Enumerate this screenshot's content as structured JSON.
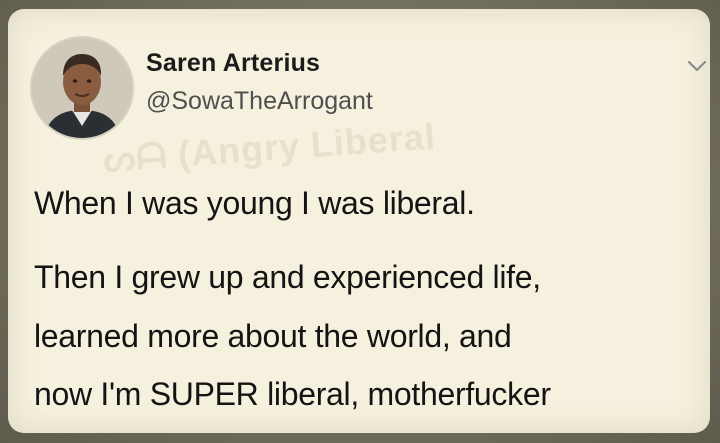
{
  "tweet": {
    "author_name": "Saren Arterius",
    "author_handle": "@SowaTheArrogant",
    "watermark": "ᔕᗩ (Angry Liberal",
    "lines": [
      "When I was young I was liberal.",
      "Then I grew up and experienced life,",
      "learned more about the world, and",
      "now I'm SUPER liberal, motherfucker"
    ]
  },
  "icons": {
    "menu": "chevron-down-icon",
    "avatar": "avatar"
  },
  "colors": {
    "card_background": "#f5f1de",
    "frame": "#6f6c5c",
    "text": "#141414",
    "handle_text": "#4f4f4f"
  }
}
